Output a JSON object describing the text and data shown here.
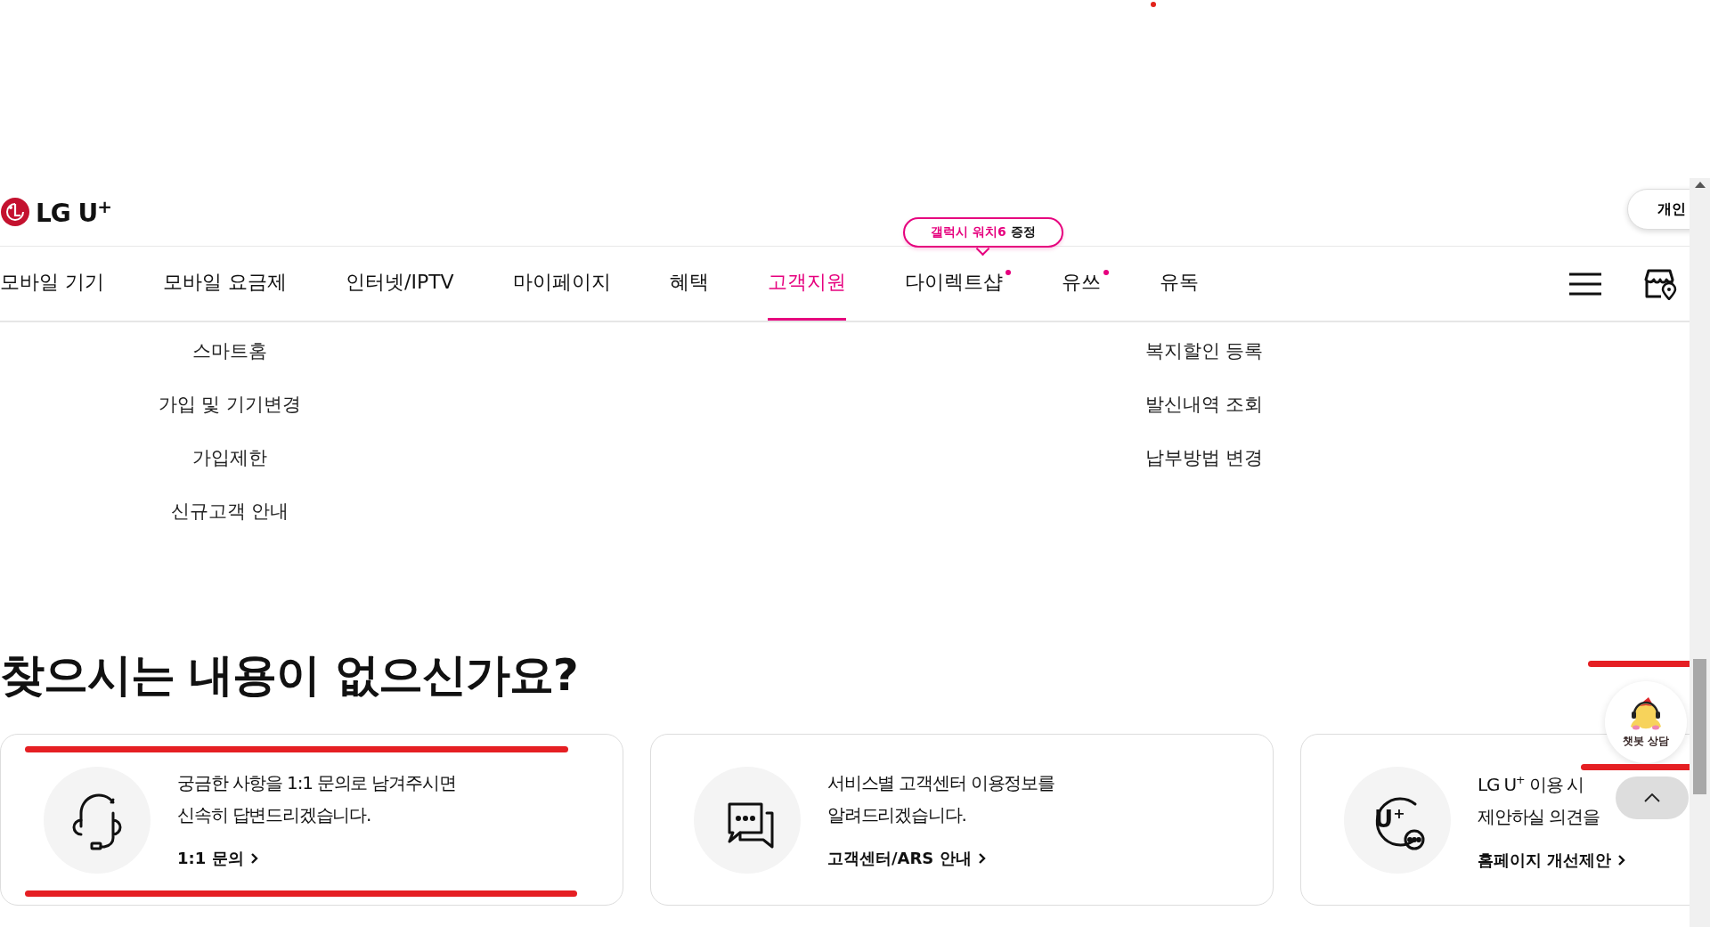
{
  "header": {
    "logo": "LG U$^{+}$",
    "segment_button": "개인"
  },
  "promo_bubble": "**갤럭시 워치6** 증정",
  "nav": [
    {
      "label": "모바일 기기",
      "selected": false,
      "badge": false
    },
    {
      "label": "모바일 요금제",
      "selected": false,
      "badge": false
    },
    {
      "label": "인터넷/IPTV",
      "selected": false,
      "badge": false
    },
    {
      "label": "마이페이지",
      "selected": false,
      "badge": false
    },
    {
      "label": "혜택",
      "selected": false,
      "badge": false
    },
    {
      "label": "고객지원",
      "selected": true,
      "badge": false
    },
    {
      "label": "다이렉트샵",
      "selected": false,
      "badge": true
    },
    {
      "label": "유쓰",
      "selected": false,
      "badge": true
    },
    {
      "label": "유독",
      "selected": false,
      "badge": false
    }
  ],
  "submenu": {
    "column_1": [
      "스마트홈",
      "가입 및 기기변경",
      "가입제한",
      "신규고객 안내"
    ],
    "column_2": [
      "복지할인 등록",
      "발신내역 조회",
      "납부방법 변경"
    ]
  },
  "heading": "찾으시는 내용이 없으신가요?",
  "cards": [
    {
      "kind": "headset",
      "lines": [
        "궁금한 사항을 1:1 문의로 남겨주시면",
        "신속히 답변드리겠습니다."
      ],
      "link": "1:1 문의"
    },
    {
      "kind": "chat",
      "lines": [
        "서비스별 고객센터 이용정보를",
        "알려드리겠습니다."
      ],
      "link": "고객센터/ARS 안내"
    },
    {
      "kind": "uplus",
      "icon_label": "U$^{+}$",
      "lines": [
        "LG U$^{+}$ 이용 시",
        "제안하실 의견을"
      ],
      "link": "홈페이지 개선제안"
    }
  ],
  "chatbot": {
    "label": "챗봇 상담"
  }
}
